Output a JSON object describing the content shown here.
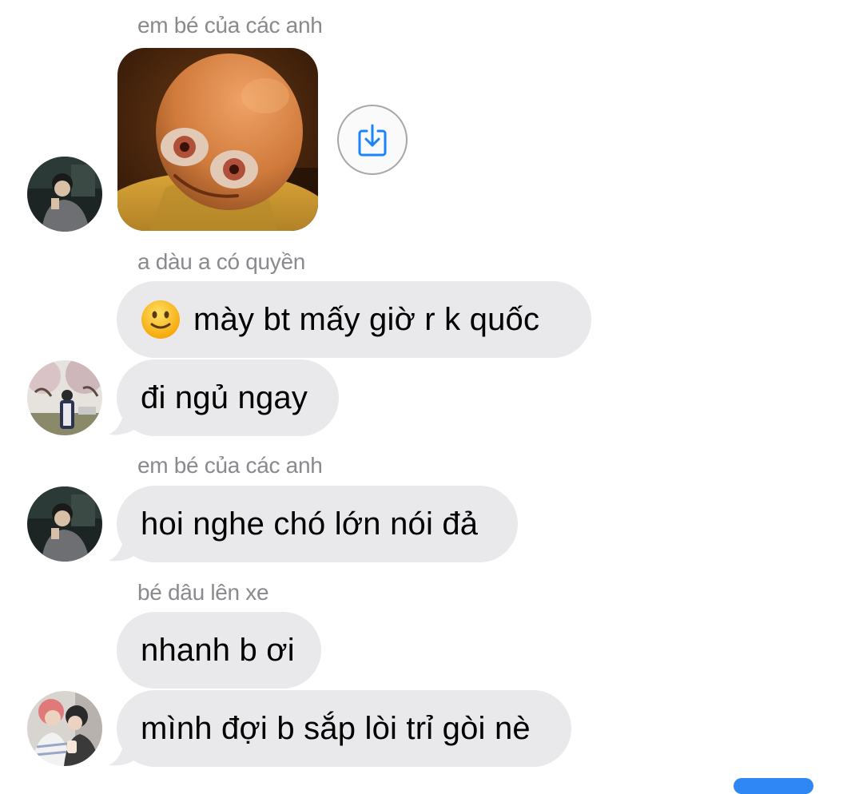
{
  "messages": [
    {
      "sender": "em bé của các anh",
      "type": "image",
      "image_alt": "sticker of an orange cartoon baby",
      "action_icon": "share-download-icon"
    },
    {
      "sender": "a dàu a có quyền",
      "type": "text",
      "emoji": "slightly-smiling-face",
      "text": "mày bt mấy giờ r k quốc"
    },
    {
      "type": "text",
      "text": "đi ngủ ngay"
    },
    {
      "sender": "em bé của các anh",
      "type": "text",
      "text": "hoi nghe chó lớn nói đả"
    },
    {
      "sender": "bé dâu lên xe",
      "type": "text",
      "text": "nhanh b ơi"
    },
    {
      "type": "text",
      "text": "mình đợi b sắp lòi trỉ gòi nè"
    }
  ],
  "colors": {
    "incoming_bubble": "#e9e9eb",
    "sender_name": "#8a8a8e",
    "save_icon": "#1a84ff",
    "outgoing_accent": "#2f86f5"
  }
}
